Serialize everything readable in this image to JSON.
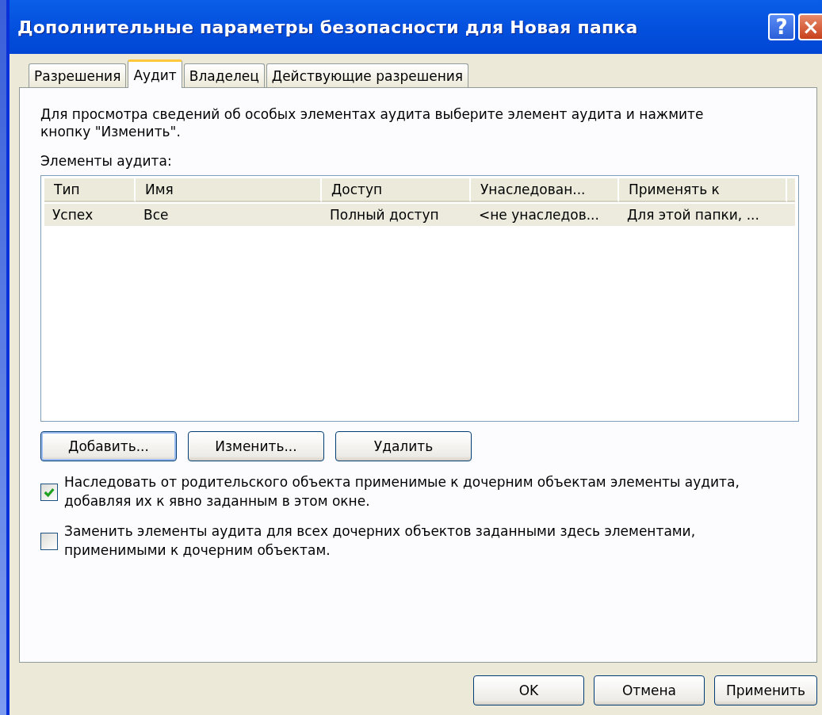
{
  "window": {
    "title": "Дополнительные параметры безопасности для Новая папка",
    "help": "?",
    "close": "×"
  },
  "tabs": [
    {
      "label": "Разрешения",
      "selected": false
    },
    {
      "label": "Аудит",
      "selected": true
    },
    {
      "label": "Владелец",
      "selected": false
    },
    {
      "label": "Действующие разрешения",
      "selected": false
    }
  ],
  "description": "Для просмотра сведений об особых элементах аудита выберите элемент аудита и нажмите кнопку \"Изменить\".",
  "list_label": "Элементы аудита:",
  "table": {
    "columns": [
      "Тип",
      "Имя",
      "Доступ",
      "Унаследован...",
      "Применять к"
    ],
    "rows": [
      {
        "cells": [
          "Успех",
          "Все",
          "Полный доступ",
          "<не унаследов...",
          "Для этой папки, ..."
        ],
        "selected": true
      }
    ]
  },
  "list_buttons": [
    "Добавить...",
    "Изменить...",
    "Удалить"
  ],
  "options": [
    {
      "label": "Наследовать от родительского объекта применимые к дочерним объектам элементы аудита, добавляя их к явно заданным в этом окне.",
      "checked": true
    },
    {
      "label": "Заменить элементы аудита для всех дочерних объектов заданными здесь элементами, применимыми к дочерним объектам.",
      "checked": false
    }
  ],
  "buttons": [
    "OK",
    "Отмена",
    "Применить"
  ]
}
